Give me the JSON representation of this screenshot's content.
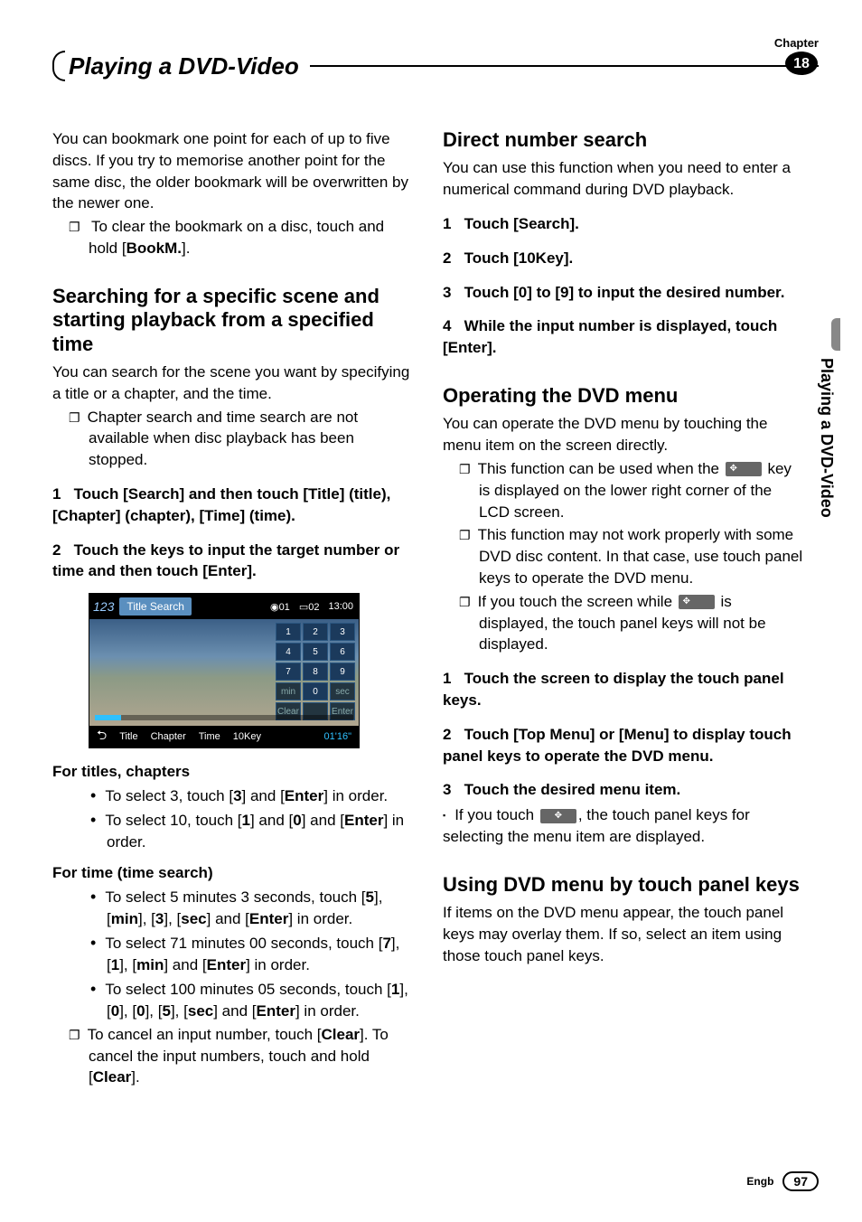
{
  "header": {
    "chapter_label": "Chapter",
    "chapter_no": "18",
    "title": "Playing a DVD-Video"
  },
  "sidetab": "Playing a DVD-Video",
  "footer": {
    "lang": "Engb",
    "page": "97"
  },
  "left": {
    "intro": "You can bookmark one point for each of up to five discs. If you try to memorise another point for the same disc, the older bookmark will be overwritten by the newer one.",
    "intro_note_a": "To clear the bookmark on a disc, touch and hold [",
    "intro_note_b": "BookM.",
    "intro_note_c": "].",
    "h2": "Searching for a specific scene and starting playback from a specified time",
    "p1": "You can search for the scene you want by specifying a title or a chapter, and the time.",
    "n1": "Chapter search and time search are not available when disc playback has been stopped.",
    "s1n": "1",
    "s1": "Touch [Search] and then touch [Title] (title), [Chapter] (chapter), [Time] (time).",
    "s2n": "2",
    "s2": "Touch the keys to input the target number or time and then touch [Enter].",
    "subA": "For titles, chapters",
    "a1_a": "To select 3, touch [",
    "a1_b": "3",
    "a1_c": "] and [",
    "a1_d": "Enter",
    "a1_e": "] in order.",
    "a2_a": "To select 10, touch [",
    "a2_b": "1",
    "a2_c": "] and [",
    "a2_d": "0",
    "a2_e": "] and [",
    "a2_f": "Enter",
    "a2_g": "] in order.",
    "subB": "For time (time search)",
    "b1_a": "To select 5 minutes 3 seconds, touch [",
    "b1_b": "5",
    "b1_c": "], [",
    "b1_d": "min",
    "b1_e": "], [",
    "b1_f": "3",
    "b1_g": "], [",
    "b1_h": "sec",
    "b1_i": "] and [",
    "b1_j": "Enter",
    "b1_k": "] in order.",
    "b2_a": "To select 71 minutes 00 seconds, touch [",
    "b2_b": "7",
    "b2_c": "], [",
    "b2_d": "1",
    "b2_e": "], [",
    "b2_f": "min",
    "b2_g": "] and [",
    "b2_h": "Enter",
    "b2_i": "] in order.",
    "b3_a": "To select 100 minutes 05 seconds, touch [",
    "b3_b": "1",
    "b3_c": "], [",
    "b3_d": "0",
    "b3_e": "], [",
    "b3_f": "0",
    "b3_g": "], [",
    "b3_h": "5",
    "b3_i": "], [",
    "b3_j": "sec",
    "b3_k": "] and [",
    "b3_l": "Enter",
    "b3_m": "] in order.",
    "b4_a": "To cancel an input number, touch [",
    "b4_b": "Clear",
    "b4_c": "]. To cancel the input numbers, touch and hold [",
    "b4_d": "Clear",
    "b4_e": "]."
  },
  "right": {
    "h2a": "Direct number search",
    "p1": "You can use this function when you need to enter a numerical command during DVD playback.",
    "s1n": "1",
    "s1": "Touch [Search].",
    "s2n": "2",
    "s2": "Touch [10Key].",
    "s3n": "3",
    "s3": "Touch [0] to [9] to input the desired number.",
    "s4n": "4",
    "s4": "While the input number is displayed, touch [Enter].",
    "h2b": "Operating the DVD menu",
    "p2": "You can operate the DVD menu by touching the menu item on the screen directly.",
    "n1a": "This function can be used when the ",
    "n1b": " key is displayed on the lower right corner of the LCD screen.",
    "n2": "This function may not work properly with some DVD disc content. In that case, use touch panel keys to operate the DVD menu.",
    "n3a": "If you touch the screen while ",
    "n3b": " is displayed, the touch panel keys will not be displayed.",
    "t1n": "1",
    "t1": "Touch the screen to display the touch panel keys.",
    "t2n": "2",
    "t2": "Touch [Top Menu] or [Menu] to display touch panel keys to operate the DVD menu.",
    "t3n": "3",
    "t3": "Touch the desired menu item.",
    "sq_a": "If you touch ",
    "sq_b": ", the touch panel keys for selecting the menu item are displayed.",
    "h2c": "Using DVD menu by touch panel keys",
    "p3": "If items on the DVD menu appear, the touch panel keys may overlay them. If so, select an item using those touch panel keys."
  },
  "figure": {
    "num": "123",
    "title": "Title Search",
    "time_total": "13:00",
    "disc": "01",
    "chap": "02",
    "keys": [
      "1",
      "2",
      "3",
      "4",
      "5",
      "6",
      "7",
      "8",
      "9",
      "min",
      "0",
      "sec",
      "Clear",
      "",
      "Enter"
    ],
    "bottom": [
      "⮌",
      "Title",
      "Chapter",
      "Time",
      "10Key",
      "01'16\""
    ]
  },
  "icon_label": "✥"
}
